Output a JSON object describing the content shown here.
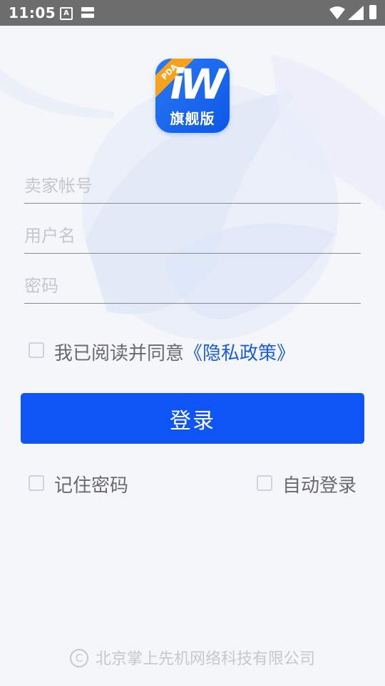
{
  "status_bar": {
    "time": "11:05",
    "a_icon_letter": "A",
    "icons": [
      "a-notification-icon",
      "storage-icon",
      "wifi-icon",
      "signal-icon",
      "battery-icon"
    ]
  },
  "logo": {
    "ribbon": "PDA",
    "mark": "iW",
    "subtitle": "旗舰版",
    "colors": {
      "primary": "#0d57e6",
      "ribbon": "#f6a21c"
    }
  },
  "form": {
    "seller_account": {
      "placeholder": "卖家帐号",
      "value": ""
    },
    "username": {
      "placeholder": "用户名",
      "value": ""
    },
    "password": {
      "placeholder": "密码",
      "value": ""
    }
  },
  "agreement": {
    "label": "我已阅读并同意",
    "policy_link": "《隐私政策》",
    "checked": false
  },
  "login_button": {
    "label": "登录",
    "color": "#0f55f5"
  },
  "options": {
    "remember_password": {
      "label": "记住密码",
      "checked": false
    },
    "auto_login": {
      "label": "自动登录",
      "checked": false
    }
  },
  "footer": {
    "copyright_symbol": "C",
    "company": "北京掌上先机网络科技有限公司"
  }
}
